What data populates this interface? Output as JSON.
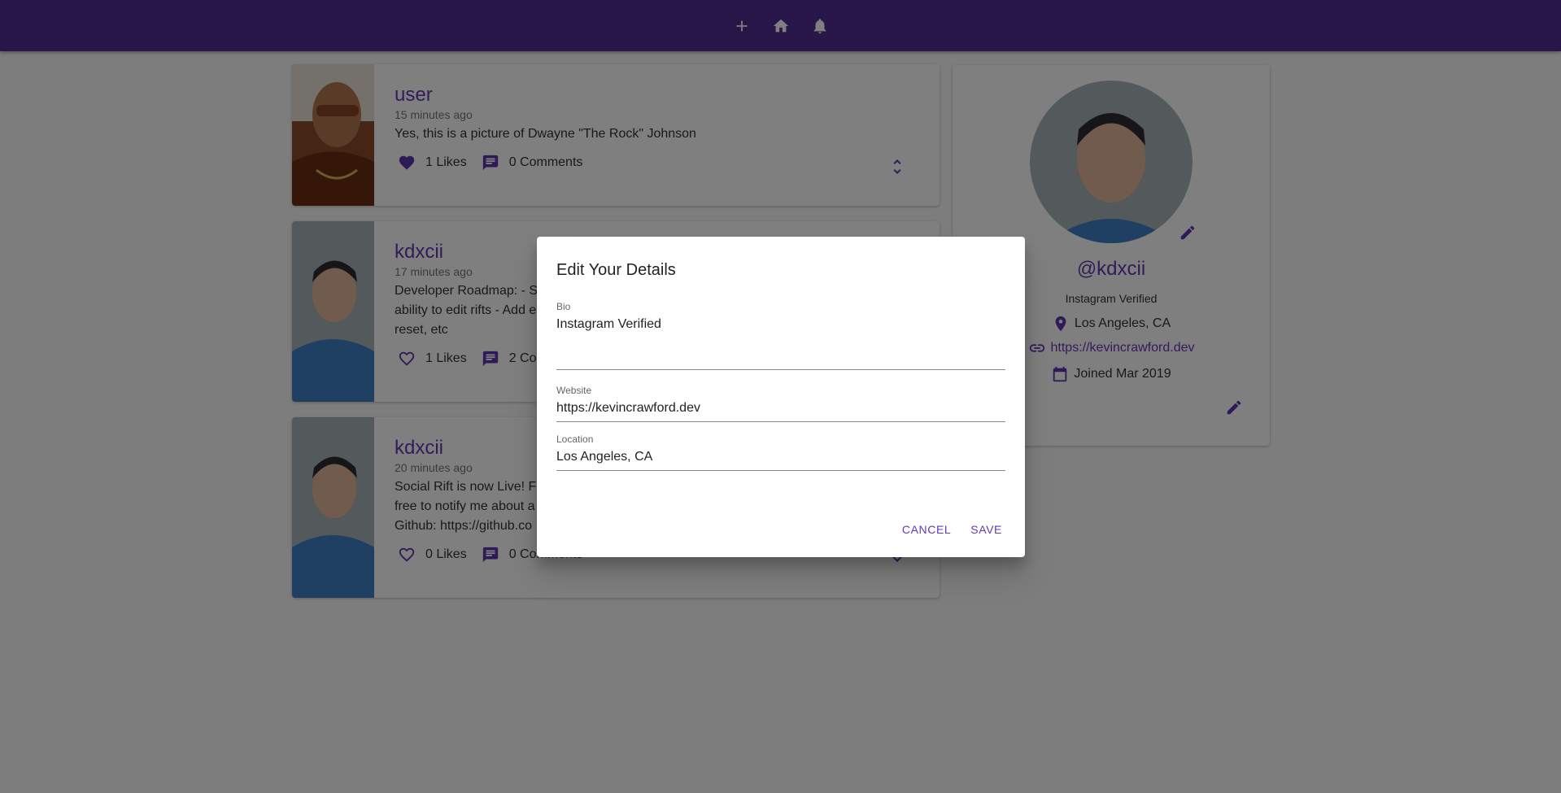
{
  "navbar": {
    "add_icon": "plus-icon",
    "home_icon": "home-icon",
    "notifications_icon": "bell-icon",
    "color": "#512d92"
  },
  "posts": [
    {
      "user": "user",
      "time": "15 minutes ago",
      "body": "Yes, this is a picture of Dwayne \"The Rock\" Johnson",
      "likes": "1 Likes",
      "comments": "0 Comments",
      "liked": true
    },
    {
      "user": "kdxcii",
      "time": "17 minutes ago",
      "body": "Developer Roadmap: - S ability to edit rifts - Add e reset, etc",
      "likes": "1 Likes",
      "comments": "2 Co",
      "liked": false
    },
    {
      "user": "kdxcii",
      "time": "20 minutes ago",
      "body": "Social Rift is now Live! F free to notify me about a Github: https://github.co",
      "likes": "0 Likes",
      "comments": "0 Comments",
      "liked": false
    }
  ],
  "profile": {
    "handle": "@kdxcii",
    "bio": "Instagram Verified",
    "location": "Los Angeles, CA",
    "website": "https://kevincrawford.dev",
    "joined": "Joined Mar 2019"
  },
  "dialog": {
    "title": "Edit Your Details",
    "bio_label": "Bio",
    "bio_value": "Instagram Verified",
    "website_label": "Website",
    "website_value": "https://kevincrawford.dev",
    "location_label": "Location",
    "location_value": "Los Angeles, CA",
    "cancel_label": "CANCEL",
    "save_label": "SAVE"
  },
  "colors": {
    "accent": "#6239b5",
    "icon": "#5e35b1"
  }
}
